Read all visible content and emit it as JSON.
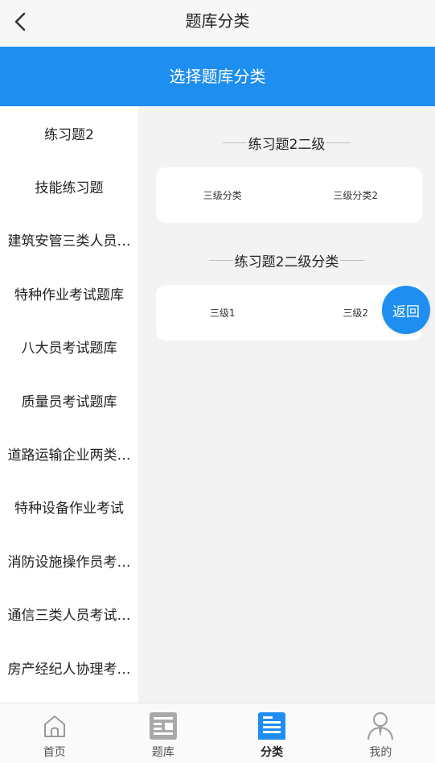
{
  "header": {
    "title": "题库分类",
    "back_icon": "chevron-left-icon"
  },
  "banner": {
    "title": "选择题库分类",
    "color": "#1e8ef0"
  },
  "sidebar": {
    "items": [
      "练习题2",
      "技能练习题",
      "建筑安管三类人员…",
      "特种作业考试题库",
      "八大员考试题库",
      "质量员考试题库",
      "道路运输企业两类…",
      "特种设备作业考试",
      "消防设施操作员考…",
      "通信三类人员考试…",
      "房产经纪人协理考…"
    ]
  },
  "sections": [
    {
      "title": "练习题2二级",
      "items": [
        "三级分类",
        "三级分类2"
      ]
    },
    {
      "title": "练习题2二级分类",
      "items": [
        "三级1",
        "三级2"
      ]
    }
  ],
  "fab": {
    "label": "返回"
  },
  "tabbar": {
    "items": [
      {
        "label": "首页",
        "icon": "home-icon",
        "active": false
      },
      {
        "label": "题库",
        "icon": "question-bank-icon",
        "active": false
      },
      {
        "label": "分类",
        "icon": "category-icon",
        "active": true
      },
      {
        "label": "我的",
        "icon": "profile-icon",
        "active": false
      }
    ]
  }
}
